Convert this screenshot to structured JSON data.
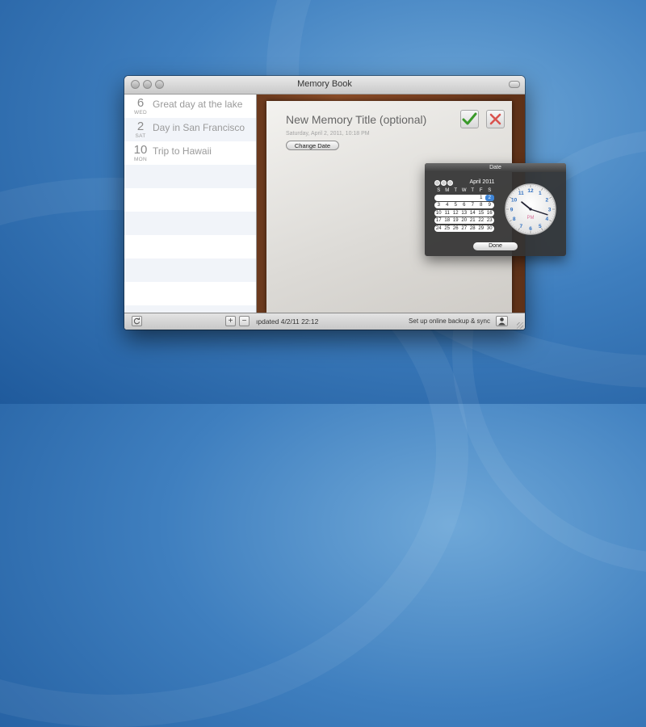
{
  "window": {
    "title": "Memory Book"
  },
  "sidebar": {
    "items": [
      {
        "day": "6",
        "dow": "WED",
        "title": "Great day at the lake"
      },
      {
        "day": "2",
        "dow": "SAT",
        "title": "Day in San Francisco"
      },
      {
        "day": "10",
        "dow": "MON",
        "title": "Trip to Hawaii"
      }
    ]
  },
  "editor": {
    "title_placeholder": "New Memory Title (optional)",
    "date_text": "Saturday, April 2, 2011, 10:18 PM",
    "change_date_label": "Change Date"
  },
  "bottombar": {
    "updated_text": "ıpdated 4/2/11 22:12",
    "backup_label": "Set up online backup & sync",
    "add_label": "+",
    "remove_label": "−"
  },
  "date_panel": {
    "title": "Date",
    "month_label": "April 2011",
    "weekday_headers": [
      "S",
      "M",
      "T",
      "W",
      "T",
      "F",
      "S"
    ],
    "weeks": [
      [
        "",
        "",
        "",
        "",
        "",
        "1",
        "2"
      ],
      [
        "3",
        "4",
        "5",
        "6",
        "7",
        "8",
        "9"
      ],
      [
        "10",
        "11",
        "12",
        "13",
        "14",
        "15",
        "16"
      ],
      [
        "17",
        "18",
        "19",
        "20",
        "21",
        "22",
        "23"
      ],
      [
        "24",
        "25",
        "26",
        "27",
        "28",
        "29",
        "30"
      ]
    ],
    "selected_day": "2",
    "clock_numbers": [
      "12",
      "1",
      "2",
      "3",
      "4",
      "5",
      "6",
      "7",
      "8",
      "9",
      "10",
      "11"
    ],
    "clock_period": "PM",
    "clock_hour": 10,
    "clock_minute": 18,
    "done_label": "Done"
  },
  "colors": {
    "accent": "#3d84d6",
    "confirm_green": "#3a9a2a",
    "cancel_red": "#d9534f",
    "clock_numbers": "#2f6fc0",
    "clock_period": "#d8729b"
  }
}
